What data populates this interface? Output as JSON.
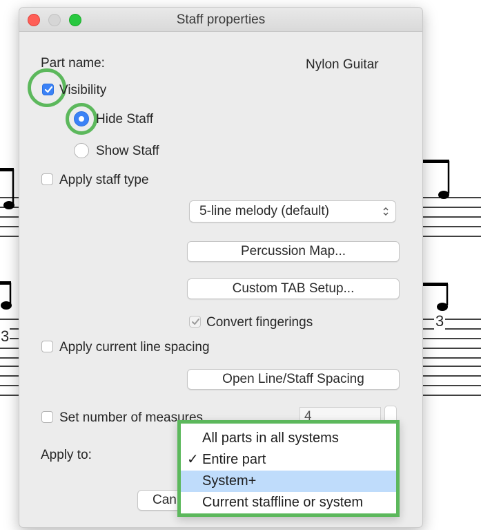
{
  "window": {
    "title": "Staff properties"
  },
  "part_name": {
    "label": "Part name:",
    "value": "Nylon Guitar"
  },
  "visibility": {
    "label": "Visibility",
    "checked": true,
    "hide_label": "Hide Staff",
    "show_label": "Show Staff",
    "selected": "Hide Staff"
  },
  "staff_type": {
    "apply_label": "Apply staff type",
    "checked": false,
    "select_value": "5-line melody (default)",
    "percussion_button": "Percussion Map...",
    "tab_button": "Custom TAB Setup...",
    "convert_label": "Convert fingerings",
    "convert_checked": true
  },
  "line_spacing": {
    "apply_label": "Apply current line spacing",
    "checked": false,
    "open_button": "Open Line/Staff Spacing"
  },
  "measures": {
    "label": "Set number of measures",
    "checked": false,
    "value": "4"
  },
  "apply_to": {
    "label": "Apply to:",
    "options": [
      {
        "label": "All parts in all systems",
        "checked": false,
        "highlighted": false
      },
      {
        "label": "Entire part",
        "checked": true,
        "highlighted": false
      },
      {
        "label": "System+",
        "checked": false,
        "highlighted": true
      },
      {
        "label": "Current staffline or system",
        "checked": false,
        "highlighted": false
      }
    ]
  },
  "footer": {
    "cancel_button": "Can"
  },
  "score": {
    "tuplet_left": "3",
    "tuplet_right": "3"
  },
  "colors": {
    "accent": "#3b82f6",
    "annotation_green": "#5cb85c",
    "menu_highlight": "#bfdcfb",
    "traffic_red": "#ff5f57",
    "traffic_green": "#28c840"
  }
}
